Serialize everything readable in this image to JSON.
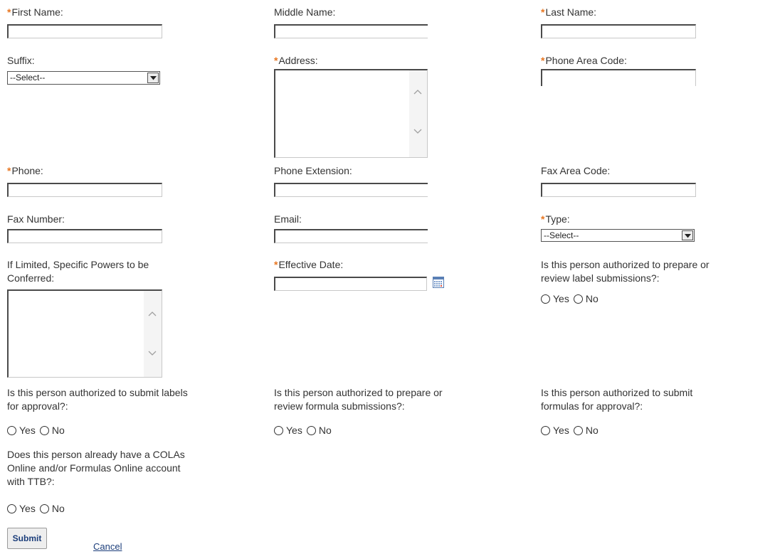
{
  "fields": {
    "first_name": {
      "label": "First Name:",
      "required": true,
      "value": ""
    },
    "middle_name": {
      "label": "Middle Name:",
      "required": false,
      "value": ""
    },
    "last_name": {
      "label": "Last Name:",
      "required": true,
      "value": ""
    },
    "suffix": {
      "label": "Suffix:",
      "required": false,
      "selected": "--Select--"
    },
    "address": {
      "label": "Address:",
      "required": true,
      "value": ""
    },
    "phone_area_code": {
      "label": "Phone Area Code:",
      "required": true,
      "value": ""
    },
    "phone": {
      "label": "Phone:",
      "required": true,
      "value": ""
    },
    "phone_extension": {
      "label": "Phone Extension:",
      "required": false,
      "value": ""
    },
    "fax_area_code": {
      "label": "Fax Area Code:",
      "required": false,
      "value": ""
    },
    "fax_number": {
      "label": "Fax Number:",
      "required": false,
      "value": ""
    },
    "email": {
      "label": "Email:",
      "required": false,
      "value": ""
    },
    "type": {
      "label": "Type:",
      "required": true,
      "selected": "--Select--"
    },
    "specific_powers": {
      "label_line1": "If Limited, Specific Powers to be",
      "label_line2": "Conferred:",
      "value": ""
    },
    "effective_date": {
      "label": "Effective Date:",
      "required": true,
      "value": ""
    }
  },
  "questions": {
    "prepare_labels": {
      "line1": "Is this person authorized to prepare or",
      "line2": "review label submissions?:"
    },
    "submit_labels": {
      "line1": "Is this person authorized to submit labels",
      "line2": "for approval?:"
    },
    "prepare_formulas": {
      "line1": "Is this person authorized to prepare or",
      "line2": "review formula submissions?:"
    },
    "submit_formulas": {
      "line1": "Is this person authorized to submit",
      "line2": "formulas for approval?:"
    },
    "existing_account": {
      "line1": "Does this person already have a COLAs",
      "line2": "Online and/or Formulas Online account",
      "line3": "with TTB?:"
    }
  },
  "options": {
    "yes": "Yes",
    "no": "No"
  },
  "required_marker": "*",
  "actions": {
    "submit": "Submit",
    "cancel": "Cancel"
  },
  "icons": {
    "calendar": "calendar-icon",
    "dropdown": "chevron-down-icon",
    "scroll_up": "scroll-up-icon",
    "scroll_down": "scroll-down-icon"
  },
  "colors": {
    "required": "#e87722",
    "link": "#1b3d7a",
    "text": "#333333"
  }
}
